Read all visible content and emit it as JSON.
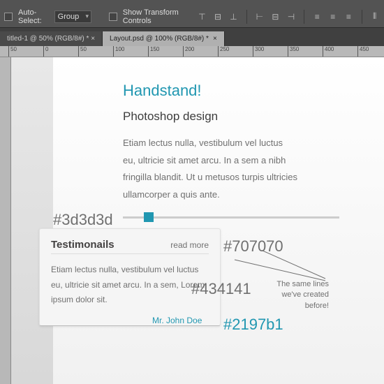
{
  "options": {
    "auto_select": "Auto-Select:",
    "group": "Group",
    "show_transform": "Show Transform Controls"
  },
  "tabs": [
    {
      "label": "titled-1 @ 50% (RGB/8#) * ×"
    },
    {
      "label": "Layout.psd @ 100% (RGB/8#) *"
    }
  ],
  "ticks": [
    "50",
    "0",
    "50",
    "100",
    "150",
    "200",
    "250",
    "300",
    "350",
    "400",
    "450"
  ],
  "content": {
    "h1": "Handstand!",
    "h2": "Photoshop design",
    "body": "Etiam lectus nulla, vestibulum vel luctus eu, ultricie sit amet arcu. In a sem a nibh fringilla blandit. Ut u metusos turpis ultricies ullamcorper a quis ante."
  },
  "card": {
    "title": "Testimonails",
    "read_more": "read more",
    "body": "Etiam lectus nulla, vestibulum vel luctus eu, ultricie sit amet arcu. In a sem, Lorem ipsum dolor sit.",
    "author": "Mr. John Doe"
  },
  "ann": {
    "c1": "#3d3d3d",
    "c2": "#707070",
    "c3": "#434141",
    "c4": "#2197b1",
    "note": "The same lines we've created before!"
  }
}
